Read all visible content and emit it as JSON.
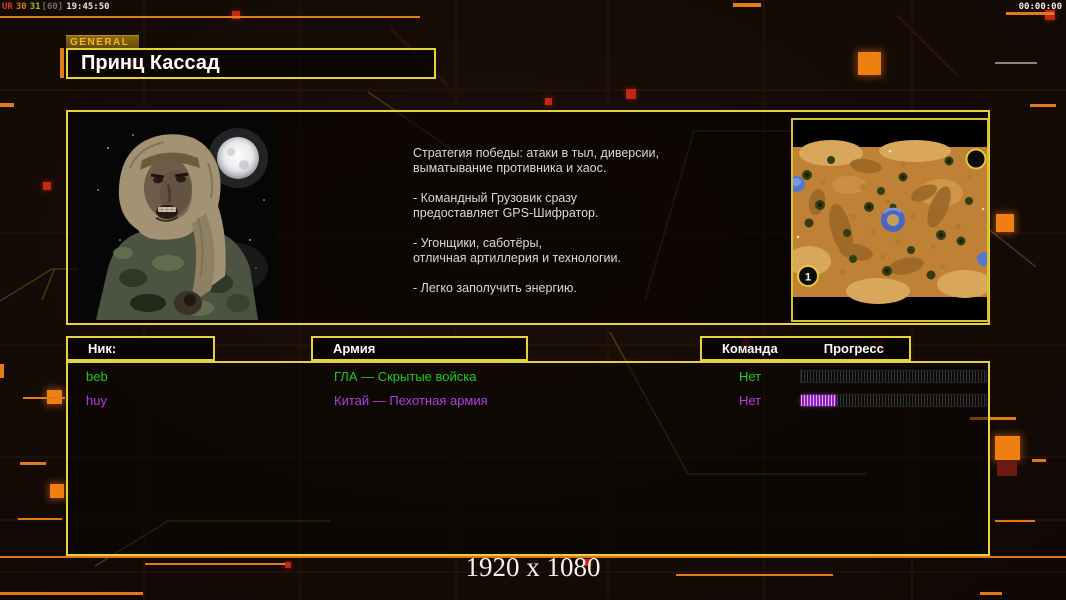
{
  "overlay": {
    "fps_app": "UR",
    "fps_val": "30",
    "fps_avg": "31",
    "fps_cap": "[60]",
    "clock": "19:45:50",
    "match_timer": "00:00:00"
  },
  "header": {
    "tab_label": "GENERAL",
    "general_name": "Принц Кассад"
  },
  "briefing": {
    "strategy_text": "Стратегия победы: атаки в тыл, диверсии,\n выматывание противника и хаос.\n\n- Командный Грузовик сразу\nпредоставляет GPS-Шифратор.\n\n- Угонщики, саботёры,\nотличная артиллерия и технологии.\n\n- Легко заполучить энергию.",
    "portrait_icon": "prince-kassad-portrait",
    "minimap_icon": "desert-map-preview"
  },
  "minimap": {
    "start_position_label": "1"
  },
  "players_table": {
    "columns": {
      "nick": "Ник:",
      "army": "Армия",
      "team": "Команда",
      "progress": "Прогресс"
    },
    "players": [
      {
        "nick": "beb",
        "army": "ГЛА — Скрытые войска",
        "team": "Нет",
        "progress_percent": 0,
        "color": "#1fca1f"
      },
      {
        "nick": "huy",
        "army": "Китай — Пехотная армия",
        "team": "Нет",
        "progress_percent": 19,
        "color": "#b13be4"
      }
    ]
  },
  "footer": {
    "resolution": "1920 x 1080"
  },
  "colors": {
    "accent_yellow": "#e6d23a",
    "accent_orange": "#e07b16",
    "gla_green": "#1fca1f",
    "china_purple": "#b13be4"
  }
}
